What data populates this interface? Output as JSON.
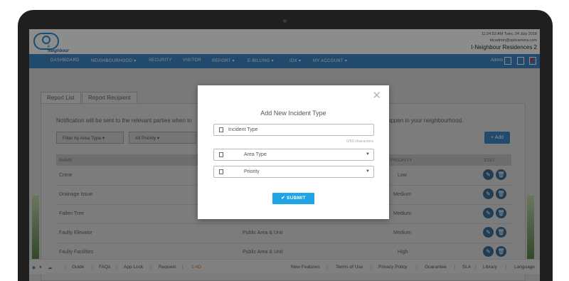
{
  "header": {
    "logo_text": "i-Neighbour",
    "datetime": "11:24:52 AM Tues, 24 July 2018",
    "email": "tdcadmin@spilcamera.com",
    "site_name": "I-Neighbour Residences 2"
  },
  "nav": {
    "items": [
      "DASHBOARD",
      "NEIGHBOURHOOD ▾",
      "SECURITY",
      "VISITOR",
      "REPORT ▾",
      "E-BILLING ▾",
      "IDX ▾",
      "MY ACCOUNT ▾"
    ],
    "user": "Admin",
    "icons": [
      "user-icon",
      "list-icon",
      "bell-icon"
    ]
  },
  "page": {
    "tabs": [
      "Report List",
      "Report Recipient"
    ],
    "notice_left": "Notification will be sent to the relevant parties when in",
    "notice_right": "appen in your neighbourhood.",
    "filters": [
      "Filter by Area Type  ▾",
      "All Priority  ▾"
    ],
    "add_label": "+ Add",
    "columns": [
      "NAME",
      "PRIORITY",
      "EDIT"
    ],
    "rows": [
      {
        "name": "Crime",
        "area": "",
        "priority": "Low"
      },
      {
        "name": "Drainage Issue",
        "area": "",
        "priority": "Medium"
      },
      {
        "name": "Fallen Tree",
        "area": "",
        "priority": "Medium"
      },
      {
        "name": "Faulty Elevator",
        "area": "Public Area & Unit",
        "priority": "Medium"
      },
      {
        "name": "Faulty Facilities",
        "area": "Public Area & Unit",
        "priority": "High"
      }
    ]
  },
  "footer": {
    "links": [
      "Guide",
      "FAQs",
      "App Lock",
      "Request",
      "1-4D"
    ],
    "right_links": [
      "New Features",
      "Terms of Use",
      "Privacy Policy",
      "Guarantee",
      "SLA",
      "Library",
      "Language"
    ]
  },
  "modal": {
    "title": "Add New Incident Type",
    "name_placeholder": "Incident Type",
    "counter": "0/50 characters",
    "area_select": "Area Type",
    "priority_select": "Priority",
    "submit_label": "✔ SUBMIT"
  },
  "colors": {
    "nav_blue": "#3d87c6",
    "submit_blue": "#1fa4e6"
  }
}
